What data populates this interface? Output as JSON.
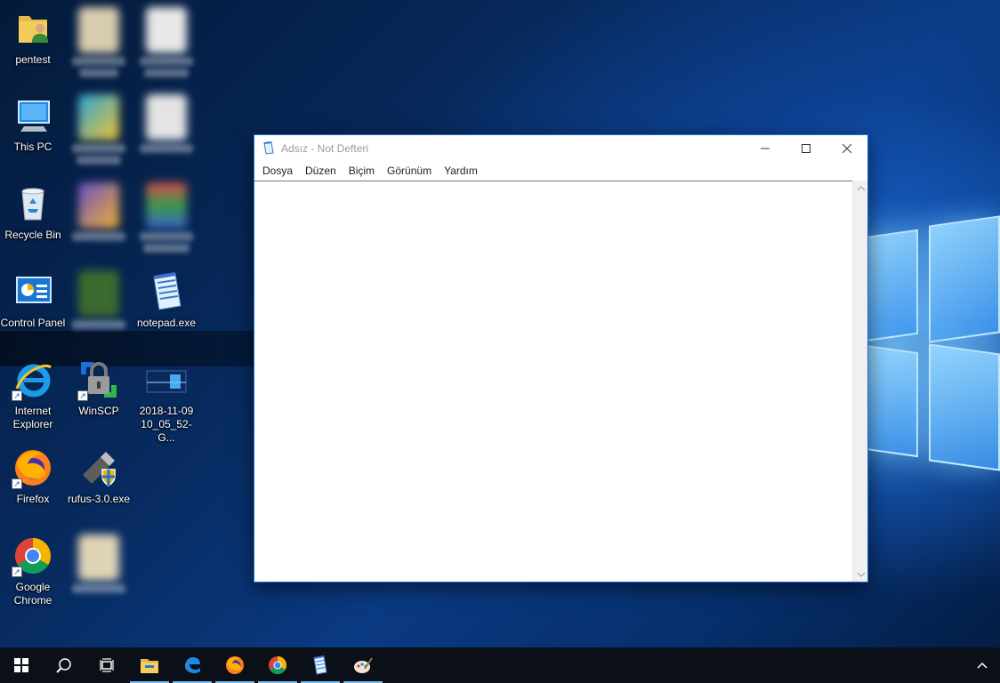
{
  "desktop": {
    "icons": {
      "pentest": "pentest",
      "this_pc": "This PC",
      "recycle_bin": "Recycle Bin",
      "control_panel": "Control Panel",
      "internet_explorer": "Internet Explorer",
      "firefox": "Firefox",
      "google_chrome": "Google Chrome",
      "winscp": "WinSCP",
      "rufus": "rufus-3.0.exe",
      "notepad_exe": "notepad.exe",
      "screenshot_file": "2018-11-09 10_05_52-G..."
    }
  },
  "notepad": {
    "title": "Adsız - Not Defteri",
    "menu": [
      "Dosya",
      "Düzen",
      "Biçim",
      "Görünüm",
      "Yardım"
    ],
    "content": ""
  },
  "taskbar": {
    "apps": [
      "start-icon",
      "search-icon",
      "task-view-icon",
      "file-explorer-icon",
      "edge-icon",
      "firefox-icon",
      "chrome-icon",
      "notepad-icon",
      "paint-icon"
    ]
  },
  "colors": {
    "window_border": "#1f6fd0",
    "taskbar_bg": "#0b0f17",
    "running_indicator": "#76b9ed"
  }
}
